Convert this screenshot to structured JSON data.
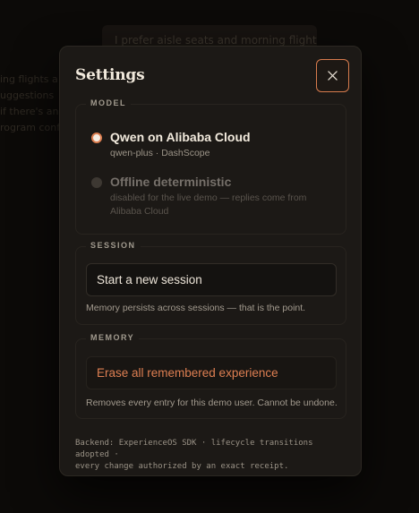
{
  "background": {
    "chip": "I prefer aisle seats and morning flights",
    "lines": [
      "ing flights a",
      "uggestions",
      "if there's an",
      "rogram conf"
    ]
  },
  "settings": {
    "title": "Settings",
    "close_icon": "close-icon",
    "model": {
      "legend": "MODEL",
      "options": [
        {
          "label": "Qwen on Alibaba Cloud",
          "detail": "qwen-plus · DashScope",
          "selected": true
        },
        {
          "label": "Offline deterministic",
          "detail": "disabled for the live demo — replies come from Alibaba Cloud",
          "selected": false
        }
      ]
    },
    "session": {
      "legend": "SESSION",
      "button_label": "Start a new session",
      "help": "Memory persists across sessions — that is the point."
    },
    "memory": {
      "legend": "MEMORY",
      "button_label": "Erase all remembered experience",
      "help": "Removes every entry for this demo user. Cannot be undone."
    },
    "footer": {
      "line1": "Backend: ExperienceOS SDK · lifecycle transitions adopted ·",
      "line2": "every change authorized by an exact receipt."
    }
  },
  "colors": {
    "accent": "#dc7e50",
    "panel": "#1c1916",
    "backdrop": "#0c0a08"
  }
}
